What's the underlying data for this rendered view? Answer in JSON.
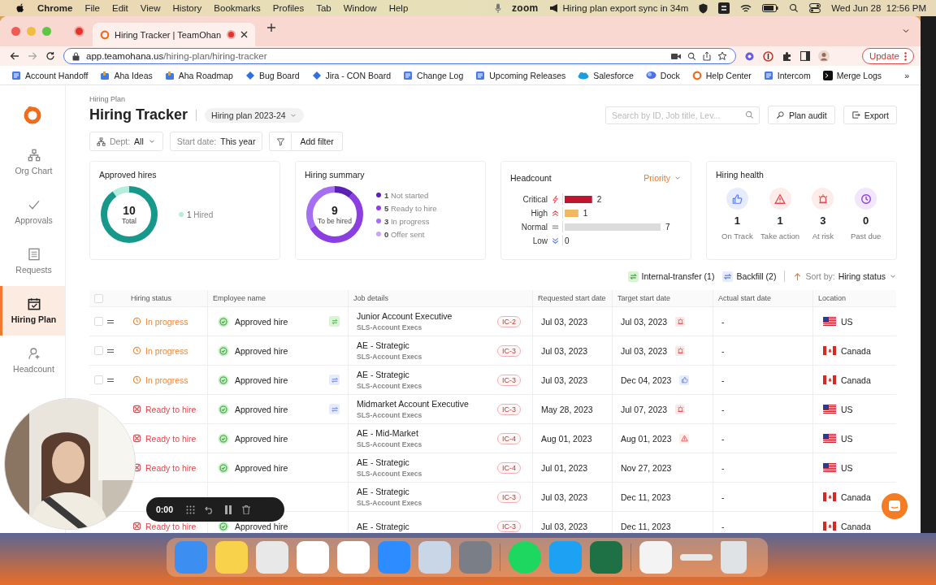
{
  "menu_bar": {
    "app": "Chrome",
    "menus": [
      "File",
      "Edit",
      "View",
      "History",
      "Bookmarks",
      "Profiles",
      "Tab",
      "Window",
      "Help"
    ],
    "zoom": "zoom",
    "notice": "Hiring plan export sync in 34m",
    "clock": "Wed Jun 28  12:56 PM"
  },
  "browser": {
    "tab_title": "Hiring Tracker | TeamOhan",
    "url_host": "app.teamohana.us",
    "url_path": "/hiring-plan/hiring-tracker",
    "update": "Update",
    "bookmarks": [
      {
        "label": "Account Handoff",
        "kind": "doc"
      },
      {
        "label": "Aha Ideas",
        "kind": "aha"
      },
      {
        "label": "Aha Roadmap",
        "kind": "aha"
      },
      {
        "label": "Bug Board",
        "kind": "diamond"
      },
      {
        "label": "Jira - CON Board",
        "kind": "diamond"
      },
      {
        "label": "Change Log",
        "kind": "doc"
      },
      {
        "label": "Upcoming Releases",
        "kind": "doc"
      },
      {
        "label": "Salesforce",
        "kind": "cloud"
      },
      {
        "label": "Dock",
        "kind": "blob"
      },
      {
        "label": "Help Center",
        "kind": "ring"
      },
      {
        "label": "Intercom",
        "kind": "doc"
      },
      {
        "label": "Merge Logs",
        "kind": "terminal"
      }
    ],
    "more": "»"
  },
  "sidebar": {
    "items": [
      {
        "label": "Org Chart",
        "kind": "org",
        "selected": false
      },
      {
        "label": "Approvals",
        "kind": "check",
        "selected": false
      },
      {
        "label": "Requests",
        "kind": "list",
        "selected": false
      },
      {
        "label": "Hiring Plan",
        "kind": "calendar",
        "selected": true
      },
      {
        "label": "Headcount",
        "kind": "person",
        "selected": false
      }
    ]
  },
  "header": {
    "breadcrumb": "Hiring Plan",
    "title": "Hiring Tracker",
    "plan": "Hiring plan 2023-24",
    "search": {
      "placeholder": "Search by ID, Job title, Lev..."
    },
    "actions": [
      {
        "label": "Plan audit",
        "kind": "audit"
      },
      {
        "label": "Export",
        "kind": "export"
      }
    ]
  },
  "filters": [
    {
      "label": "Dept:",
      "value": "All",
      "kind": "dept"
    },
    {
      "label": "Start date:",
      "value": "This year",
      "kind": "plain"
    }
  ],
  "add_filter": "Add filter",
  "approved_hires": {
    "title": "Approved hires",
    "total": "10",
    "total_label": "Total",
    "hired": "1",
    "hired_label": "Hired"
  },
  "hiring_summary": {
    "title": "Hiring summary",
    "total": "9",
    "total_label": "To be hired",
    "items": [
      {
        "count": "1",
        "label": "Not started",
        "color": "#5b21b6"
      },
      {
        "count": "5",
        "label": "Ready to hire",
        "color": "#8b3fe0"
      },
      {
        "count": "3",
        "label": "In progress",
        "color": "#a66ef0"
      },
      {
        "count": "0",
        "label": "Offer sent",
        "color": "#c9a8f2"
      }
    ]
  },
  "headcount": {
    "title": "Headcount",
    "sort": "Priority",
    "rows": [
      {
        "label": "Critical",
        "kind": "critical",
        "count": "2",
        "color": "#c0152f"
      },
      {
        "label": "High",
        "kind": "high",
        "count": "1",
        "color": "#f2b860"
      },
      {
        "label": "Normal",
        "kind": "normal",
        "count": "7",
        "color": "#dcdcdc"
      },
      {
        "label": "Low",
        "kind": "low",
        "count": "0"
      }
    ]
  },
  "hiring_health": {
    "title": "Hiring health",
    "items": [
      {
        "kind": "track",
        "count": "1",
        "label": "On Track"
      },
      {
        "kind": "action",
        "count": "1",
        "label": "Take action"
      },
      {
        "kind": "risk",
        "count": "3",
        "label": "At risk"
      },
      {
        "kind": "due",
        "count": "0",
        "label": "Past due"
      }
    ]
  },
  "legend": [
    {
      "label": "Internal-transfer (1)",
      "kind": "transfer"
    },
    {
      "label": "Backfill (2)",
      "kind": "backfill"
    }
  ],
  "sort": {
    "label": "Sort by:",
    "value": "Hiring status"
  },
  "table": {
    "select_all": {
      "checked": false
    },
    "columns": [
      "Hiring status",
      "Employee name",
      "Job details",
      "Requested start date",
      "Target start date",
      "Actual start date",
      "Location"
    ],
    "rows": [
      {
        "checked": false,
        "status": {
          "label": "In progress",
          "kind": "progress"
        },
        "employee": "Approved hire",
        "tag": {
          "kind": "transfer"
        },
        "title": "Junior Account Executive",
        "team": "SLS-Account Execs",
        "level": "IC-2",
        "requested": "Jul 03, 2023",
        "target": {
          "date": "Jul 03, 2023",
          "kind": "risk"
        },
        "actual": "-",
        "location": {
          "name": "US",
          "kind": "us"
        }
      },
      {
        "checked": false,
        "status": {
          "label": "In progress",
          "kind": "progress"
        },
        "employee": "Approved hire",
        "title": "AE - Strategic",
        "team": "SLS-Account Execs",
        "level": "IC-3",
        "requested": "Jul 03, 2023",
        "target": {
          "date": "Jul 03, 2023",
          "kind": "risk"
        },
        "actual": "-",
        "location": {
          "name": "Canada",
          "kind": "ca"
        }
      },
      {
        "checked": false,
        "status": {
          "label": "In progress",
          "kind": "progress"
        },
        "employee": "Approved hire",
        "tag": {
          "kind": "backfill"
        },
        "title": "AE - Strategic",
        "team": "SLS-Account Execs",
        "level": "IC-3",
        "requested": "Jul 03, 2023",
        "target": {
          "date": "Dec 04, 2023",
          "kind": "track"
        },
        "actual": "-",
        "location": {
          "name": "Canada",
          "kind": "ca"
        }
      },
      {
        "status": {
          "label": "Ready to hire",
          "kind": "ready"
        },
        "employee": "Approved hire",
        "tag": {
          "kind": "backfill"
        },
        "title": "Midmarket Account Executive",
        "team": "SLS-Account Execs",
        "level": "IC-3",
        "requested": "May 28, 2023",
        "target": {
          "date": "Jul 07, 2023",
          "kind": "risk"
        },
        "actual": "-",
        "location": {
          "name": "US",
          "kind": "us"
        }
      },
      {
        "status": {
          "label": "Ready to hire",
          "kind": "ready"
        },
        "employee": "Approved hire",
        "title": "AE - Mid-Market",
        "team": "SLS-Account Execs",
        "level": "IC-4",
        "requested": "Aug 01, 2023",
        "target": {
          "date": "Aug 01, 2023",
          "kind": "action"
        },
        "actual": "-",
        "location": {
          "name": "US",
          "kind": "us"
        }
      },
      {
        "status": {
          "label": "Ready to hire",
          "kind": "ready"
        },
        "employee": "Approved hire",
        "title": "AE - Strategic",
        "team": "SLS-Account Execs",
        "level": "IC-4",
        "requested": "Jul 01, 2023",
        "target": {
          "date": "Nov 27, 2023"
        },
        "actual": "-",
        "location": {
          "name": "US",
          "kind": "us"
        }
      },
      {
        "title": "AE - Strategic",
        "team": "SLS-Account Execs",
        "level": "IC-3",
        "requested": "Jul 03, 2023",
        "target": {
          "date": "Dec 11, 2023"
        },
        "actual": "-",
        "location": {
          "name": "Canada",
          "kind": "ca"
        }
      },
      {
        "status": {
          "label": "Ready to hire",
          "kind": "ready"
        },
        "employee": "Approved hire",
        "title": "AE - Strategic",
        "level": "IC-3",
        "requested": "Jul 03, 2023",
        "target": {
          "date": "Dec 11, 2023"
        },
        "actual": "-",
        "location": {
          "name": "Canada",
          "kind": "ca"
        }
      }
    ]
  },
  "recorder": {
    "time": "0:00"
  }
}
